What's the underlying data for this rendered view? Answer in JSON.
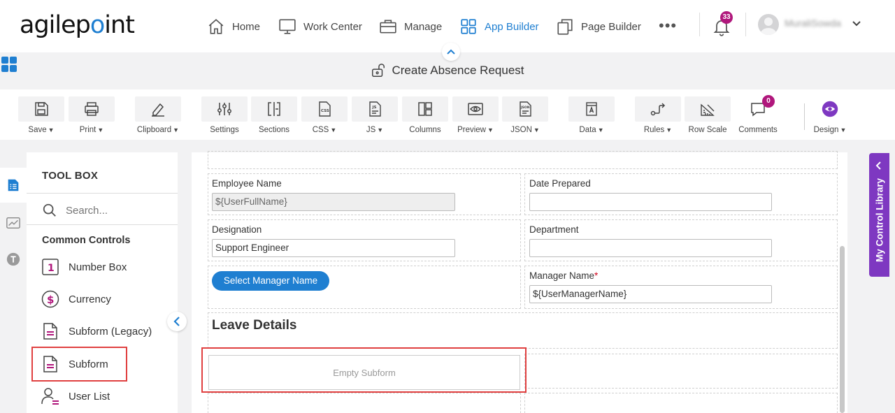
{
  "brand": {
    "logo_pre": "agilep",
    "logo_dot": "o",
    "logo_post": "int"
  },
  "nav": {
    "items": [
      {
        "label": "Home",
        "icon": "home-icon"
      },
      {
        "label": "Work Center",
        "icon": "monitor-icon"
      },
      {
        "label": "Manage",
        "icon": "briefcase-icon"
      },
      {
        "label": "App Builder",
        "icon": "grid-icon",
        "active": true
      },
      {
        "label": "Page Builder",
        "icon": "pages-icon"
      }
    ],
    "more": "•••",
    "notifications": "33",
    "username": "MuraliSowda"
  },
  "form_title": "Create Absence Request",
  "toolbar": {
    "save": "Save",
    "print": "Print",
    "clipboard": "Clipboard",
    "settings": "Settings",
    "sections": "Sections",
    "css": "CSS",
    "js": "JS",
    "columns": "Columns",
    "preview": "Preview",
    "json": "JSON",
    "data": "Data",
    "rules": "Rules",
    "row_scale": "Row Scale",
    "comments": "Comments",
    "comments_count": "0",
    "design": "Design"
  },
  "toolbox": {
    "title": "TOOL BOX",
    "search_placeholder": "Search...",
    "section": "Common Controls",
    "items": [
      {
        "label": "Number Box",
        "icon": "number-box-icon"
      },
      {
        "label": "Currency",
        "icon": "currency-icon"
      },
      {
        "label": "Subform (Legacy)",
        "icon": "subform-legacy-icon"
      },
      {
        "label": "Subform",
        "icon": "subform-icon",
        "highlighted": true
      },
      {
        "label": "User List",
        "icon": "user-list-icon"
      }
    ]
  },
  "form": {
    "employee_name_label": "Employee Name",
    "employee_name_value": "${UserFullName}",
    "date_prepared_label": "Date Prepared",
    "date_prepared_value": "",
    "designation_label": "Designation",
    "designation_value": "Support Engineer",
    "department_label": "Department",
    "department_value": "",
    "select_manager_button": "Select Manager Name",
    "manager_name_label": "Manager Name",
    "manager_required": "*",
    "manager_name_value": "${UserManagerName}",
    "leave_details_heading": "Leave Details",
    "empty_subform": "Empty Subform"
  },
  "right_panel": {
    "label": "My Control Library"
  },
  "colors": {
    "accent": "#1f7fd1",
    "badge": "#b0177c",
    "purple": "#7e38c1",
    "highlight": "#e04040"
  }
}
